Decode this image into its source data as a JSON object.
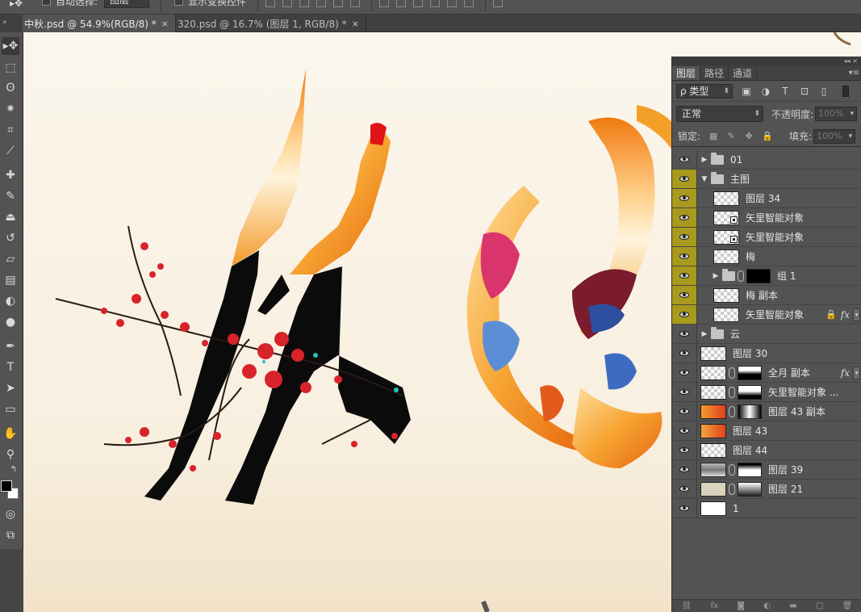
{
  "options_bar": {
    "tool_glyph": "▸✥",
    "auto_select_label": "自动选择:",
    "auto_select_value": "图层",
    "show_transform_label": "显示变换控件"
  },
  "doc_tabs": [
    {
      "label": "中秋.psd @ 54.9%(RGB/8) *",
      "close": "×",
      "active": true
    },
    {
      "label": "320.psd @ 16.7% (图层 1, RGB/8) *",
      "close": "×",
      "active": false
    }
  ],
  "collapse_glyph": "»",
  "tools": [
    {
      "name": "move-tool",
      "glyph": "▸✥"
    },
    {
      "name": "marquee-tool",
      "glyph": "⬚"
    },
    {
      "name": "lasso-tool",
      "glyph": "ʘ"
    },
    {
      "name": "magic-wand-tool",
      "glyph": "✷"
    },
    {
      "name": "crop-tool",
      "glyph": "⌗"
    },
    {
      "name": "eyedropper-tool",
      "glyph": "⟋"
    },
    {
      "name": "healing-brush-tool",
      "glyph": "✚"
    },
    {
      "name": "brush-tool",
      "glyph": "✎"
    },
    {
      "name": "clone-stamp-tool",
      "glyph": "⏏"
    },
    {
      "name": "history-brush-tool",
      "glyph": "↺"
    },
    {
      "name": "eraser-tool",
      "glyph": "▱"
    },
    {
      "name": "gradient-tool",
      "glyph": "▤"
    },
    {
      "name": "blur-tool",
      "glyph": "◐"
    },
    {
      "name": "dodge-tool",
      "glyph": "●"
    },
    {
      "name": "pen-tool",
      "glyph": "✒"
    },
    {
      "name": "type-tool",
      "glyph": "T"
    },
    {
      "name": "path-selection-tool",
      "glyph": "➤"
    },
    {
      "name": "shape-tool",
      "glyph": "▭"
    },
    {
      "name": "hand-tool",
      "glyph": "✋"
    },
    {
      "name": "zoom-tool",
      "glyph": "⚲"
    }
  ],
  "extra_tools": {
    "swap": "↰",
    "quickmask": "◎",
    "screenmode": "⧉"
  },
  "panel": {
    "tabs": [
      "图层",
      "路径",
      "通道"
    ],
    "top_glyph": "◂◂ ×",
    "menu_glyph": "▾≡",
    "filter_label": "ρ 类型",
    "filter_arrow": "⬍",
    "filter_icons": [
      "▣",
      "◑",
      "T",
      "⊡",
      "▯"
    ],
    "blend_mode": "正常",
    "blend_arrow": "⬍",
    "opacity_label": "不透明度:",
    "opacity_value": "100%",
    "lock_label": "锁定:",
    "lock_icons": [
      "▦",
      "✎",
      "✥",
      "🔒"
    ],
    "fill_label": "填充:",
    "fill_value": "100%",
    "bottom_icons": [
      "⛓",
      "fx",
      "◙",
      "◐",
      "▬",
      "▢",
      "🗑"
    ]
  },
  "layers": [
    {
      "name": "01",
      "type": "group",
      "collapsed": true,
      "highlight": false
    },
    {
      "name": "主图",
      "type": "group",
      "collapsed": false,
      "highlight": true
    },
    {
      "name": "图层 34",
      "type": "layer",
      "indent": true,
      "highlight": true
    },
    {
      "name": "矢里智能对象",
      "type": "smart",
      "indent": true,
      "highlight": true
    },
    {
      "name": "矢里智能对象",
      "type": "smart",
      "indent": true,
      "highlight": true
    },
    {
      "name": "梅",
      "type": "layer",
      "indent": true,
      "highlight": true
    },
    {
      "name": "组 1",
      "type": "group-masked",
      "indent": true,
      "collapsed": true,
      "highlight": true
    },
    {
      "name": "梅 副本",
      "type": "layer",
      "indent": true,
      "highlight": true
    },
    {
      "name": "矢里智能对象",
      "type": "smart",
      "indent": true,
      "highlight": true,
      "locked": true,
      "fx": true
    },
    {
      "name": "云",
      "type": "group",
      "collapsed": true,
      "highlight": false
    },
    {
      "name": "图层 30",
      "type": "layer",
      "highlight": false
    },
    {
      "name": "全月 副本",
      "type": "masked",
      "highlight": false,
      "fx": true
    },
    {
      "name": "矢里智能对象 ...",
      "type": "masked",
      "highlight": false
    },
    {
      "name": "图层 43 副本",
      "type": "masked-orange",
      "highlight": false
    },
    {
      "name": "图层 43",
      "type": "orange",
      "highlight": false
    },
    {
      "name": "图层 44",
      "type": "layer",
      "highlight": false
    },
    {
      "name": "图层 39",
      "type": "masked-photo",
      "highlight": false
    },
    {
      "name": "图层 21",
      "type": "masked-beige",
      "highlight": false
    },
    {
      "name": "1",
      "type": "white",
      "highlight": false
    }
  ],
  "colors": {
    "highlight": "#a89a1c",
    "canvas_bg": "#fbf6ec",
    "ink": "#0a0a0a",
    "orange": "#f08a1a",
    "red_plum": "#d8232a"
  }
}
